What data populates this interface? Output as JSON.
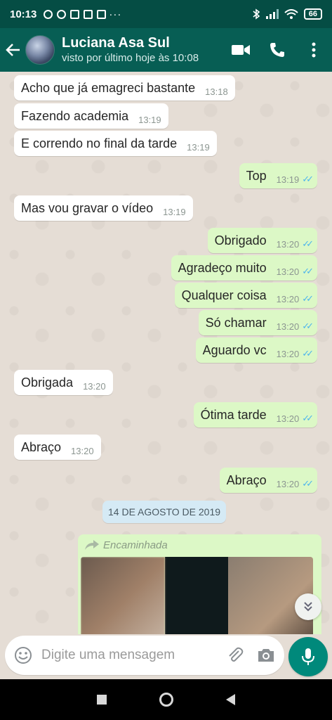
{
  "status_bar": {
    "time": "10:13",
    "overflow_dots": "···",
    "battery": "66"
  },
  "header": {
    "contact_name": "Luciana Asa Sul",
    "last_seen": "visto por último hoje às 10:08"
  },
  "messages": [
    {
      "dir": "in",
      "text": "Acho que já emagreci bastante",
      "time": "13:18"
    },
    {
      "dir": "in",
      "text": "Fazendo academia",
      "time": "13:19"
    },
    {
      "dir": "in",
      "text": "E correndo no final da tarde",
      "time": "13:19"
    },
    {
      "dir": "out",
      "text": "Top",
      "time": "13:19",
      "read": "✓✓"
    },
    {
      "dir": "in",
      "text": "Mas vou gravar o vídeo",
      "time": "13:19"
    },
    {
      "dir": "out",
      "text": "Obrigado",
      "time": "13:20",
      "read": "✓✓"
    },
    {
      "dir": "out",
      "text": "Agradeço muito",
      "time": "13:20",
      "read": "✓✓"
    },
    {
      "dir": "out",
      "text": "Qualquer coisa",
      "time": "13:20",
      "read": "✓✓"
    },
    {
      "dir": "out",
      "text": "Só chamar",
      "time": "13:20",
      "read": "✓✓"
    },
    {
      "dir": "out",
      "text": "Aguardo vc",
      "time": "13:20",
      "read": "✓✓"
    },
    {
      "dir": "in",
      "text": "Obrigada",
      "time": "13:20"
    },
    {
      "dir": "out",
      "text": "Ótima tarde",
      "time": "13:20",
      "read": "✓✓"
    },
    {
      "dir": "in",
      "text": "Abraço",
      "time": "13:20"
    },
    {
      "dir": "out",
      "text": "Abraço",
      "time": "13:20",
      "read": "✓✓"
    }
  ],
  "date_separator": "14 DE AGOSTO DE 2019",
  "forwarded": {
    "label": "Encaminhada"
  },
  "composer": {
    "placeholder": "Digite uma mensagem"
  },
  "colors": {
    "header": "#075e54",
    "outgoing_bubble": "#dcf8c6",
    "incoming_bubble": "#ffffff",
    "read_ticks": "#4fb6ec",
    "mic_button": "#00897b"
  }
}
